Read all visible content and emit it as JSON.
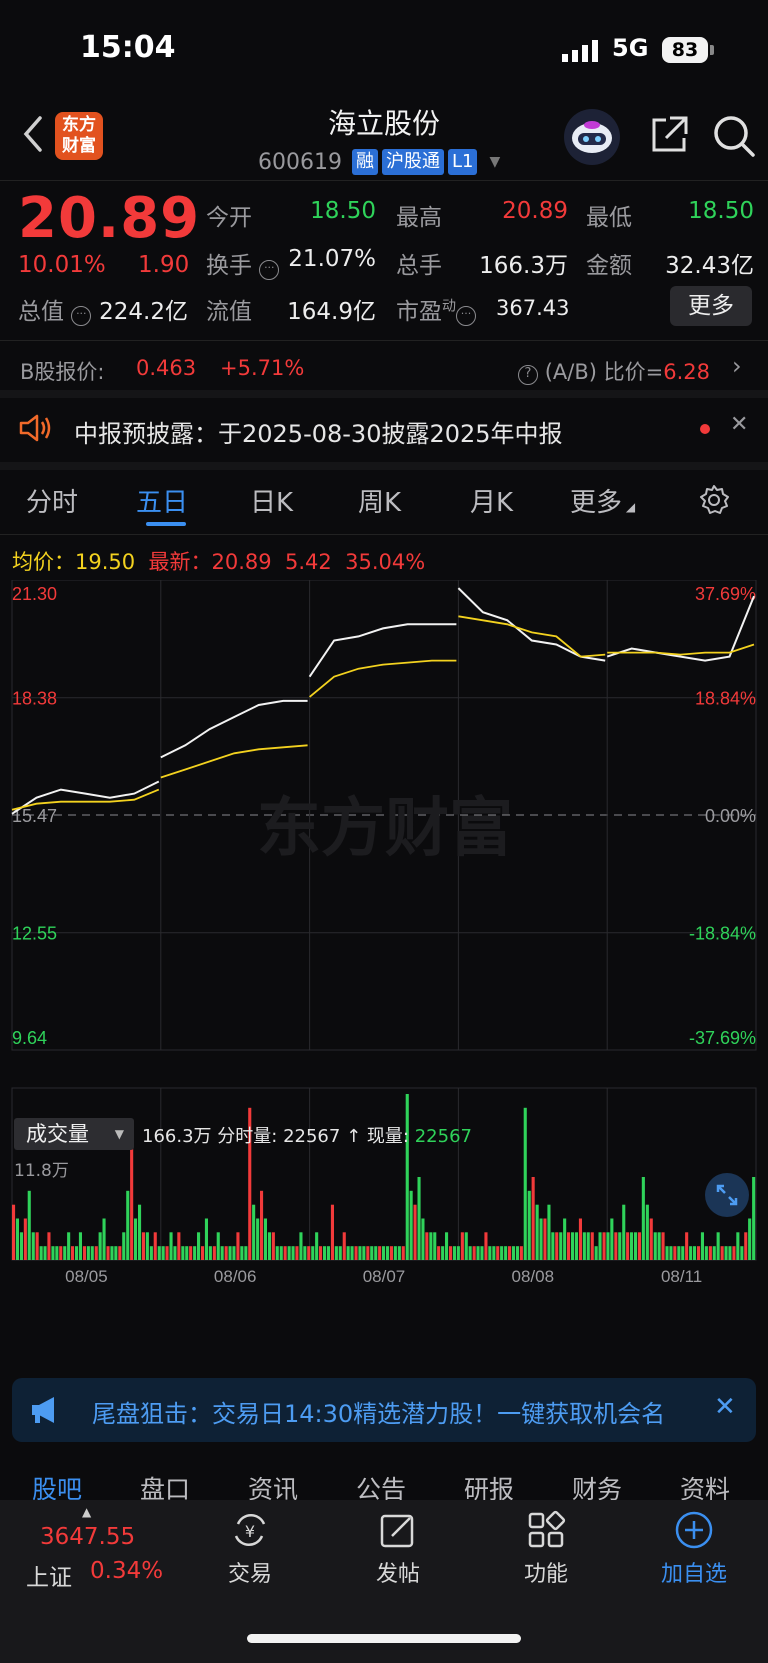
{
  "status_bar": {
    "time": "15:04",
    "network": "5G",
    "battery": "83"
  },
  "header": {
    "title": "海立股份",
    "code": "600619",
    "badges": [
      "融",
      "沪股通",
      "L1"
    ],
    "logo_text": [
      "东方",
      "财富"
    ]
  },
  "quote": {
    "price": "20.89",
    "change_pct": "10.01%",
    "change": "1.90",
    "open_label": "今开",
    "open": "18.50",
    "high_label": "最高",
    "high": "20.89",
    "low_label": "最低",
    "low": "18.50",
    "turnover_label": "换手",
    "turnover": "21.07%",
    "volume_label": "总手",
    "volume": "166.3万",
    "amount_label": "金额",
    "amount": "32.43亿",
    "mcap_label": "总值",
    "mcap": "224.2亿",
    "float_label": "流值",
    "float": "164.9亿",
    "pe_label": "市盈",
    "pe_sup": "动",
    "pe": "367.43",
    "more": "更多"
  },
  "b_share": {
    "label": "B股报价:",
    "price": "0.463",
    "pct": "+5.71%",
    "ratio_label": "(A/B) 比价=",
    "ratio": "6.28"
  },
  "notice": {
    "text": "中报预披露：于2025-08-30披露2025年中报"
  },
  "tabs": [
    "分时",
    "五日",
    "日K",
    "周K",
    "月K",
    "更多"
  ],
  "active_tab": "五日",
  "legend": {
    "avg_label": "均价：",
    "avg": "19.50",
    "last_label": "最新：",
    "last": "20.89",
    "change": "5.42",
    "pct": "35.04%"
  },
  "chart_data": {
    "type": "line",
    "watermark": "东方财富",
    "y_left_ticks": [
      "21.30",
      "18.38",
      "15.47",
      "12.55",
      "9.64"
    ],
    "y_right_ticks": [
      "37.69%",
      "18.84%",
      "0.00%",
      "-18.84%",
      "-37.69%"
    ],
    "ylim": [
      9.64,
      21.3
    ],
    "prev_close": 15.47,
    "days": [
      "08/05",
      "08/06",
      "08/07",
      "08/08",
      "08/11"
    ],
    "series": [
      {
        "values": [
          15.5,
          15.9,
          16.1,
          16.0,
          15.9,
          16.0,
          16.3,
          16.9,
          17.2,
          17.6,
          17.9,
          18.2,
          18.3,
          18.3,
          18.9,
          19.8,
          19.9,
          20.1,
          20.2,
          20.2,
          20.2,
          21.1,
          20.5,
          20.3,
          19.8,
          19.7,
          19.4,
          19.3,
          19.4,
          19.6,
          19.5,
          19.4,
          19.3,
          19.4,
          20.9
        ]
      },
      {
        "values": [
          15.6,
          15.75,
          15.8,
          15.8,
          15.8,
          15.85,
          16.1,
          16.4,
          16.6,
          16.8,
          17.0,
          17.1,
          17.15,
          17.2,
          18.4,
          18.9,
          19.1,
          19.2,
          19.25,
          19.3,
          19.3,
          20.4,
          20.3,
          20.2,
          20.0,
          19.9,
          19.4,
          19.45,
          19.5,
          19.5,
          19.5,
          19.45,
          19.5,
          19.5,
          19.7
        ]
      }
    ],
    "volume": {
      "label": "成交量",
      "total": "166.3万",
      "slot_label": "分时量:",
      "slot_value": "22567",
      "arrow": "↑",
      "now_label": "现量:",
      "now_value": "22567",
      "max_label": "11.8万",
      "bars": [
        4,
        3,
        2,
        3,
        5,
        2,
        2,
        1,
        1,
        2,
        1,
        1,
        1,
        1,
        2,
        1,
        1,
        2,
        1,
        1,
        1,
        1,
        2,
        3,
        1,
        1,
        1,
        1,
        2,
        5,
        10,
        3,
        4,
        2,
        2,
        1,
        2,
        1,
        1,
        1,
        2,
        1,
        2,
        1,
        1,
        1,
        1,
        2,
        1,
        3,
        1,
        1,
        2,
        1,
        1,
        1,
        1,
        2,
        1,
        1,
        11,
        4,
        3,
        5,
        3,
        2,
        2,
        1,
        1,
        1,
        1,
        1,
        1,
        2,
        1,
        1,
        1,
        2,
        1,
        1,
        1,
        4,
        1,
        1,
        2,
        1,
        1,
        1,
        1,
        1,
        1,
        1,
        1,
        1,
        1,
        1,
        1,
        1,
        1,
        1,
        12,
        5,
        4,
        6,
        3,
        2,
        2,
        2,
        1,
        1,
        2,
        1,
        1,
        1,
        2,
        2,
        1,
        1,
        1,
        1,
        2,
        1,
        1,
        1,
        1,
        1,
        1,
        1,
        1,
        1,
        11,
        5,
        6,
        4,
        3,
        3,
        4,
        2,
        2,
        2,
        3,
        2,
        2,
        2,
        3,
        2,
        2,
        2,
        1,
        2,
        2,
        2,
        3,
        2,
        2,
        4,
        2,
        2,
        2,
        2,
        6,
        4,
        3,
        2,
        2,
        2,
        1,
        1,
        1,
        1,
        1,
        2,
        1,
        1,
        1,
        2,
        1,
        1,
        1,
        2,
        1,
        1,
        1,
        1,
        2,
        1,
        2,
        3,
        6
      ]
    }
  },
  "banner": {
    "text": "尾盘狙击：交易日14:30精选潜力股！一键获取机会名"
  },
  "bottom_tabs": [
    "股吧",
    "盘口",
    "资讯",
    "公告",
    "研报",
    "财务",
    "资料"
  ],
  "index": {
    "value": "3647.55",
    "name": "上证",
    "pct": "0.34%"
  },
  "nav": [
    "交易",
    "发帖",
    "功能",
    "加自选"
  ],
  "colors": {
    "up": "#f23a3a",
    "down": "#2fd35a",
    "accent": "#3b8ff0",
    "avg_line": "#f3d21f"
  }
}
